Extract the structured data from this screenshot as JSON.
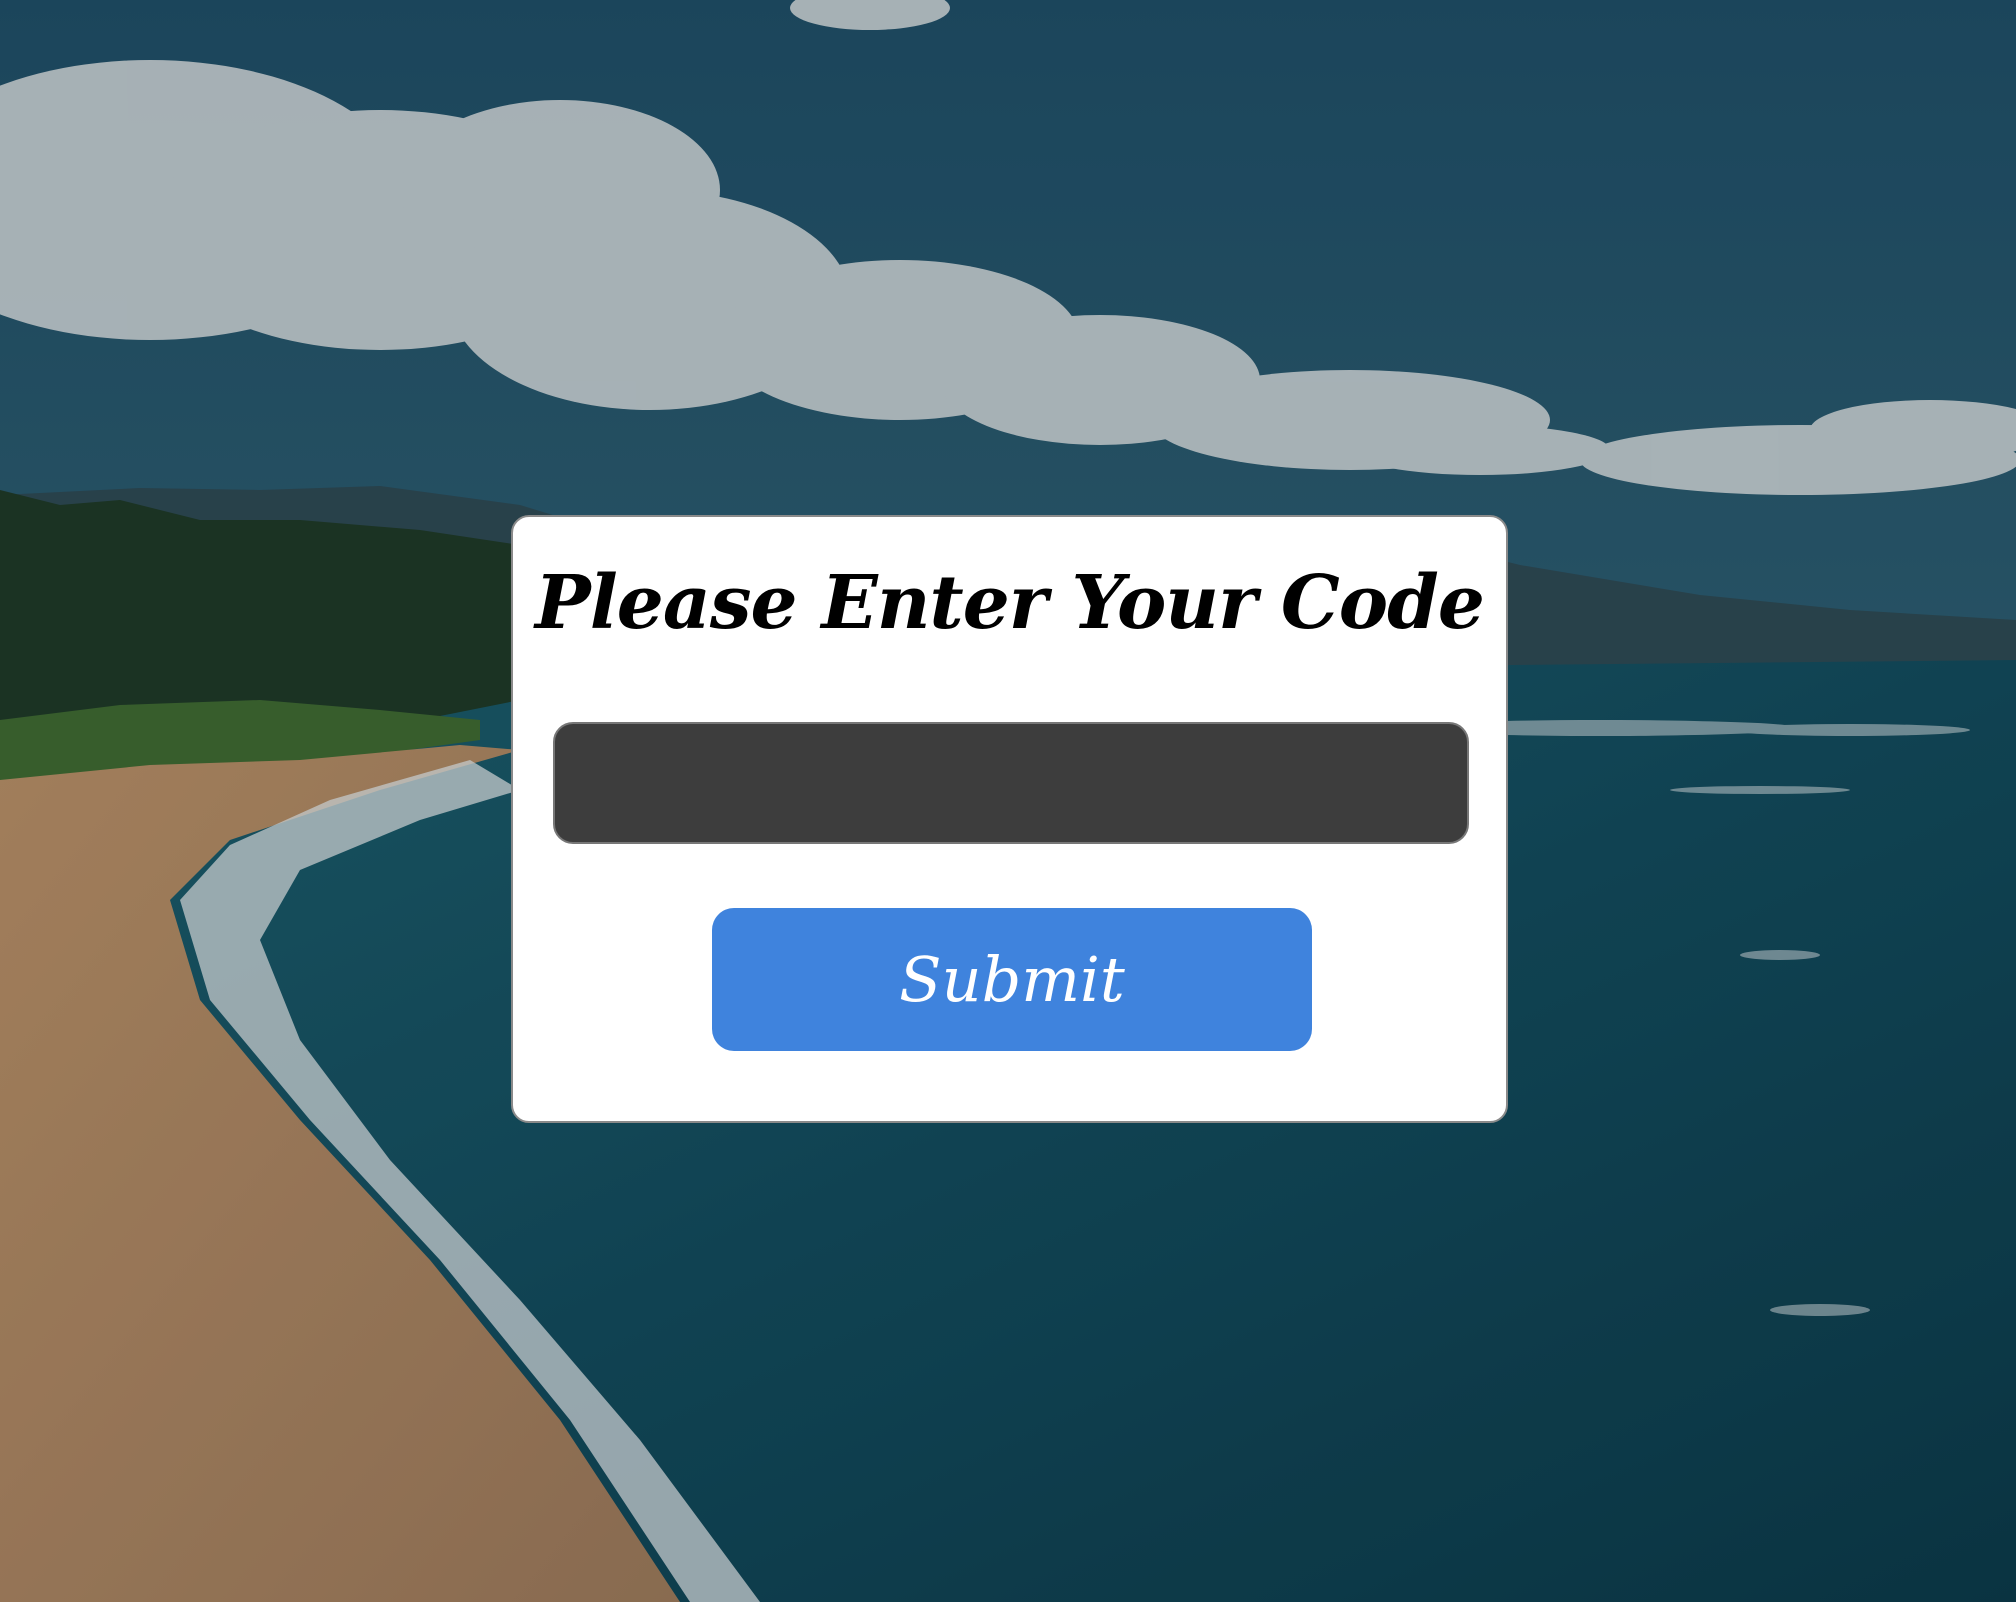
{
  "dialog": {
    "title": "Please Enter Your Code",
    "code_input": {
      "value": "",
      "placeholder": ""
    },
    "submit_label": "Submit"
  },
  "colors": {
    "dialog_background": "#ffffff",
    "input_background": "#3d3d3d",
    "submit_button": "#3f83dd",
    "submit_text": "#ffffff"
  }
}
